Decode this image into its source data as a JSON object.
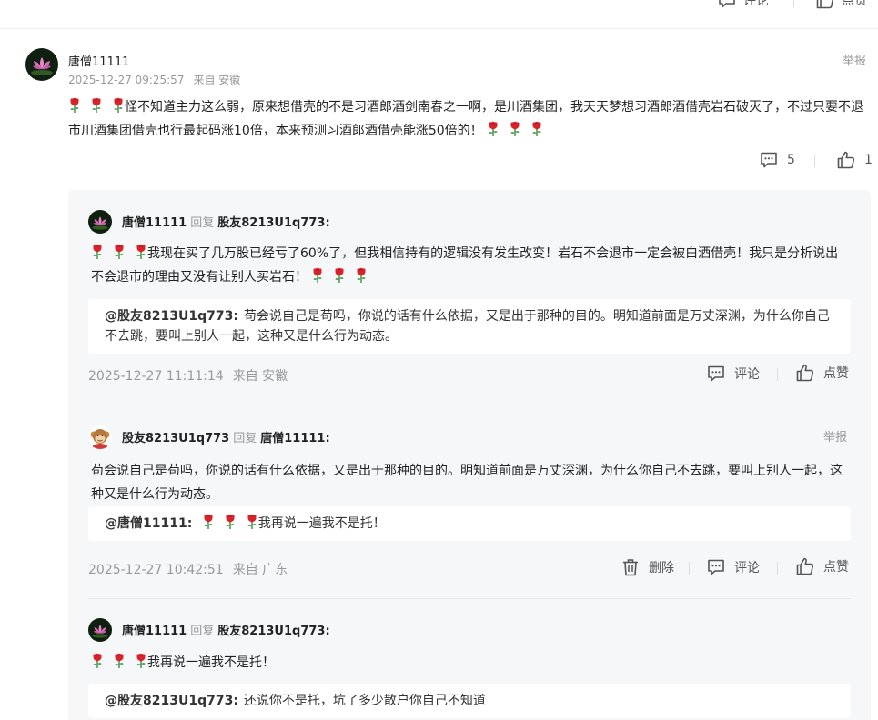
{
  "top": {
    "comment_label": "评论",
    "like_label": "点赞"
  },
  "main": {
    "username": "唐僧11111",
    "timestamp": "2025-12-27 09:25:57",
    "location": "来自 安徽",
    "report_label": "举报",
    "text": "怪不知道主力这么弱，原来想借壳的不是习酒郎酒剑南春之一啊，是川酒集团，我天天梦想习酒郎酒借壳岩石破灭了，不过只要不退市川酒集团借壳也行最起码涨10倍，本来预测习酒郎酒借壳能涨50倍的！",
    "comment_count": "5",
    "like_count": "1"
  },
  "replies": [
    {
      "username": "唐僧11111",
      "reply_word": "回复",
      "target": "股友8213U1q773:",
      "text": "我现在买了几万股已经亏了60%了，但我相信持有的逻辑没有发生改变！岩石不会退市一定会被白酒借壳！我只是分析说出不会退市的理由又没有让别人买岩石！",
      "quote_user": "@股友8213U1q773:",
      "quote_text": "苟会说自己是苟吗，你说的话有什么依据，又是出于那种的目的。明知道前面是万丈深渊，为什么你自己不去跳，要叫上别人一起，这种又是什么行为动态。",
      "timestamp": "2025-12-27 11:11:14",
      "location": "来自 安徽",
      "comment_label": "评论",
      "like_label": "点赞"
    },
    {
      "username": "股友8213U1q773",
      "reply_word": "回复",
      "target": "唐僧11111:",
      "report_label": "举报",
      "text": "苟会说自己是苟吗，你说的话有什么依据，又是出于那种的目的。明知道前面是万丈深渊，为什么你自己不去跳，要叫上别人一起，这种又是什么行为动态。",
      "quote_user": "@唐僧11111:",
      "quote_text": "我再说一遍我不是托！",
      "timestamp": "2025-12-27 10:42:51",
      "location": "来自 广东",
      "delete_label": "删除",
      "comment_label": "评论",
      "like_label": "点赞"
    },
    {
      "username": "唐僧11111",
      "reply_word": "回复",
      "target": "股友8213U1q773:",
      "text": "我再说一遍我不是托！",
      "quote_user": "@股友8213U1q773:",
      "quote_text": "还说你不是托，坑了多少散户你自己不知道"
    }
  ],
  "icons": {
    "comment": "comment-icon",
    "like": "thumbs-up-icon",
    "delete": "trash-icon",
    "rose": "rose-emoji-icon"
  },
  "colors": {
    "rose": "#d9232a",
    "stem": "#3a8f3a",
    "muted": "#999999"
  }
}
